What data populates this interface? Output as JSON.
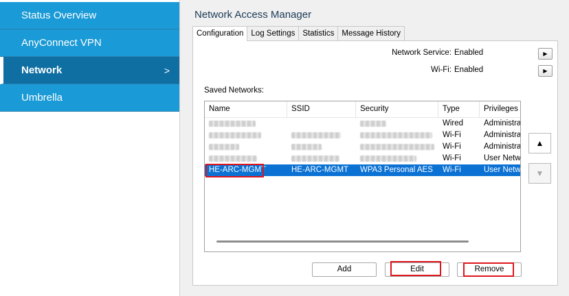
{
  "sidebar": {
    "items": [
      {
        "label": "Status Overview"
      },
      {
        "label": "AnyConnect VPN"
      },
      {
        "label": "Network",
        "chevron": ">"
      },
      {
        "label": "Umbrella"
      }
    ]
  },
  "main": {
    "title": "Network Access Manager",
    "tabs": [
      {
        "label": "Configuration"
      },
      {
        "label": "Log Settings"
      },
      {
        "label": "Statistics"
      },
      {
        "label": "Message History"
      }
    ],
    "network_service": {
      "label": "Network Service:",
      "value": "Enabled"
    },
    "wifi": {
      "label": "Wi-Fi:",
      "value": "Enabled"
    },
    "saved_networks_label": "Saved Networks:",
    "table": {
      "columns": [
        "Name",
        "SSID",
        "Security",
        "Type",
        "Privileges"
      ],
      "rows": [
        {
          "name": "",
          "ssid": "",
          "security": "",
          "type": "Wired",
          "privileges": "Administrat"
        },
        {
          "name": "",
          "ssid": "",
          "security": "",
          "type": "Wi-Fi",
          "privileges": "Administrat"
        },
        {
          "name": "",
          "ssid": "",
          "security": "",
          "type": "Wi-Fi",
          "privileges": "Administrat"
        },
        {
          "name": "",
          "ssid": "",
          "security": "",
          "type": "Wi-Fi",
          "privileges": "User Netwo"
        },
        {
          "name": "HE-ARC-MGMT",
          "ssid": "HE-ARC-MGMT",
          "security": "WPA3 Personal AES",
          "type": "Wi-Fi",
          "privileges": "User Netwo"
        }
      ]
    },
    "buttons": {
      "add": "Add",
      "edit": "Edit",
      "remove": "Remove"
    },
    "arrows": {
      "expand": "▶",
      "up": "▲",
      "down": "▼"
    },
    "colors": {
      "accent": "#1a9ad6",
      "active_nav": "#0f6fa3",
      "selection": "#0b72d4",
      "highlight": "#e0141b"
    }
  }
}
